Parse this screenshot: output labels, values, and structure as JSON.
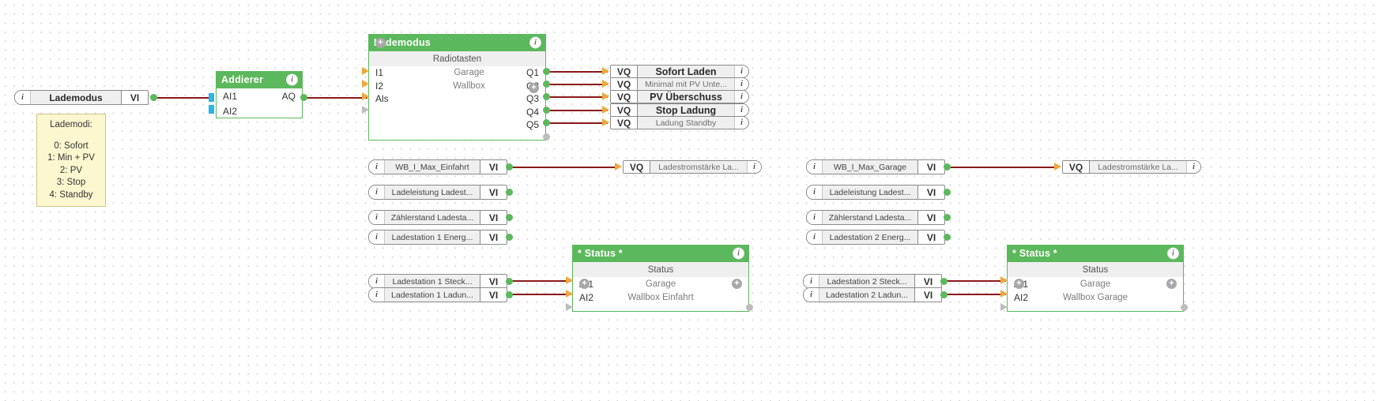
{
  "app": {
    "type": "fbd-logic-editor",
    "canvas_background": "#ffffff",
    "grid_dot_color": "#c9c9c9",
    "accent_green": "#5cb85c",
    "wire_color": "#8b1a1a",
    "input_pin_color": "#f0a93c",
    "output_pin_color": "#5cb85c",
    "blue_pin_color": "#29b6e8",
    "note_color": "#fdf7cf"
  },
  "icons": {
    "info": "i",
    "plus": "+"
  },
  "terminals": {
    "vi_tag": "VI",
    "vq_tag": "VQ"
  },
  "inputs": {
    "lademodus": {
      "name": "Lademodus",
      "tag": "VI",
      "icon": "info-icon"
    },
    "wb_i_max_einfahrt": {
      "name": "WB_I_Max_Einfahrt",
      "tag": "VI"
    },
    "ladeleistung_ladest_1": {
      "name": "Ladeleistung Ladest...",
      "tag": "VI"
    },
    "zaehlerstand_ladesta_1": {
      "name": "Zählerstand Ladesta...",
      "tag": "VI"
    },
    "ladestation_1_energ": {
      "name": "Ladestation 1 Energ...",
      "tag": "VI"
    },
    "ladestation_1_steck": {
      "name": "Ladestation 1 Steck...",
      "tag": "VI"
    },
    "ladestation_1_ladun": {
      "name": "Ladestation 1 Ladun...",
      "tag": "VI"
    },
    "wb_i_max_garage": {
      "name": "WB_I_Max_Garage",
      "tag": "VI"
    },
    "ladeleistung_ladest_2": {
      "name": "Ladeleistung Ladest...",
      "tag": "VI"
    },
    "zaehlerstand_ladesta_2": {
      "name": "Zählerstand Ladesta...",
      "tag": "VI"
    },
    "ladestation_2_energ": {
      "name": "Ladestation 2 Energ...",
      "tag": "VI"
    },
    "ladestation_2_steck": {
      "name": "Ladestation 2 Steck...",
      "tag": "VI"
    },
    "ladestation_2_ladun": {
      "name": "Ladestation 2 Ladun...",
      "tag": "VI"
    }
  },
  "blocks": {
    "addierer": {
      "title": "Addierer",
      "inputs": [
        "AI1",
        "AI2"
      ],
      "outputs": [
        "AQ"
      ]
    },
    "lademodus": {
      "title": "Lademodus",
      "subtitle": "Radiotasten",
      "inputs": [
        "I1",
        "I2",
        "Als"
      ],
      "input_descriptions": [
        "Garage",
        "Wallbox",
        ""
      ],
      "outputs": [
        "Q1",
        "Q2",
        "Q3",
        "Q4",
        "Q5"
      ]
    },
    "status_1": {
      "title": "* Status *",
      "subtitle": "Status",
      "inputs": [
        "AI1",
        "AI2"
      ],
      "input_descriptions": [
        "Garage",
        "Wallbox Einfahrt"
      ]
    },
    "status_2": {
      "title": "* Status *",
      "subtitle": "Status",
      "inputs": [
        "AI1",
        "AI2"
      ],
      "input_descriptions": [
        "Garage",
        "Wallbox Garage"
      ]
    }
  },
  "outputs": {
    "q1": {
      "tag": "VQ",
      "name": "Sofort Laden",
      "bold": true
    },
    "q2": {
      "tag": "VQ",
      "name": "Minimal mit PV Unte...",
      "bold": false
    },
    "q3": {
      "tag": "VQ",
      "name": "PV Überschuss",
      "bold": true
    },
    "q4": {
      "tag": "VQ",
      "name": "Stop Ladung",
      "bold": true
    },
    "q5": {
      "tag": "VQ",
      "name": "Ladung Standby",
      "bold": false
    },
    "ladestrom_einfahrt": {
      "tag": "VQ",
      "name": "Ladestromstärke La...",
      "bold": false
    },
    "ladestrom_garage": {
      "tag": "VQ",
      "name": "Ladestromstärke La...",
      "bold": false
    }
  },
  "note": {
    "title": "Lademodi:",
    "lines": [
      "0: Sofort",
      "1: Min + PV",
      "2: PV",
      "3: Stop",
      "4: Standby"
    ]
  }
}
